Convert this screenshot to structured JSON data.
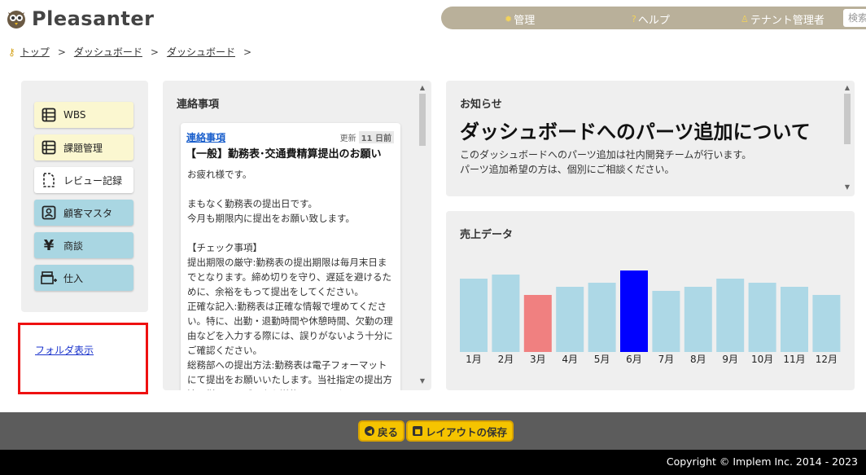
{
  "app": {
    "name": "Pleasanter"
  },
  "topnav": {
    "items": [
      {
        "label": "管理",
        "icon": "gear-icon"
      },
      {
        "label": "ヘルプ",
        "icon": "help-icon"
      },
      {
        "label": "テナント管理者",
        "icon": "user-icon"
      }
    ],
    "search_placeholder": "検索"
  },
  "breadcrumb": [
    "トップ",
    "ダッシュボード",
    "ダッシュボード"
  ],
  "breadcrumb_sep": ">",
  "menu": [
    {
      "label": "WBS",
      "icon": "table-icon",
      "color": "yellow"
    },
    {
      "label": "課題管理",
      "icon": "table-icon",
      "color": "yellow"
    },
    {
      "label": "レビュー記録",
      "icon": "document-icon",
      "color": "white"
    },
    {
      "label": "顧客マスタ",
      "icon": "contact-icon",
      "color": "blue"
    },
    {
      "label": "商談",
      "icon": "yen-icon",
      "color": "blue"
    },
    {
      "label": "仕入",
      "icon": "register-icon",
      "color": "blue"
    }
  ],
  "folder_link": "フォルダ表示",
  "notice": {
    "title": "連絡事項",
    "category": "連絡事項",
    "updated_label": "更新",
    "updated_value": "11 日前",
    "headline": "【一般】勤務表･交通費精算提出のお願い",
    "body": "お疲れ様です。\n\nまもなく勤務表の提出日です。\n今月も期限内に提出をお願い致します。\n\n【チェック事項】\n提出期限の厳守:勤務表の提出期限は毎月末日までとなります。締め切りを守り、遅延を避けるために、余裕をもって提出をしてください。\n正確な記入:勤務表は正確な情報で埋めてください。特に、出勤・退勤時間や休憩時間、欠勤の理由などを入力する際には、誤りがないよう十分にご確認ください。\n総務部への提出方法:勤務表は電子フォーマットにて提出をお願いいたします。当社指定の提出方法に従って、データを送信してください。"
  },
  "news": {
    "title": "お知らせ",
    "headline": "ダッシュボードへのパーツ追加について",
    "body": "このダッシュボードへのパーツ追加は社内開発チームが行います。\nパーツ追加希望の方は、個別にご相談ください。"
  },
  "sales": {
    "title": "売上データ"
  },
  "chart_data": {
    "type": "bar",
    "title": "売上データ",
    "categories": [
      "1月",
      "2月",
      "3月",
      "4月",
      "5月",
      "6月",
      "7月",
      "8月",
      "9月",
      "10月",
      "11月",
      "12月"
    ],
    "values": [
      18,
      19,
      14,
      16,
      17,
      20,
      15,
      16,
      18,
      17,
      16,
      14
    ],
    "colors": [
      "#add8e6",
      "#add8e6",
      "#f08080",
      "#add8e6",
      "#add8e6",
      "#0000ff",
      "#add8e6",
      "#add8e6",
      "#add8e6",
      "#add8e6",
      "#add8e6",
      "#add8e6"
    ],
    "ylim": [
      0,
      20
    ],
    "grid": false
  },
  "footer": {
    "back_label": "戻る",
    "save_label": "レイアウトの保存",
    "copyright": "Copyright © Implem Inc. 2014 - 2023"
  }
}
